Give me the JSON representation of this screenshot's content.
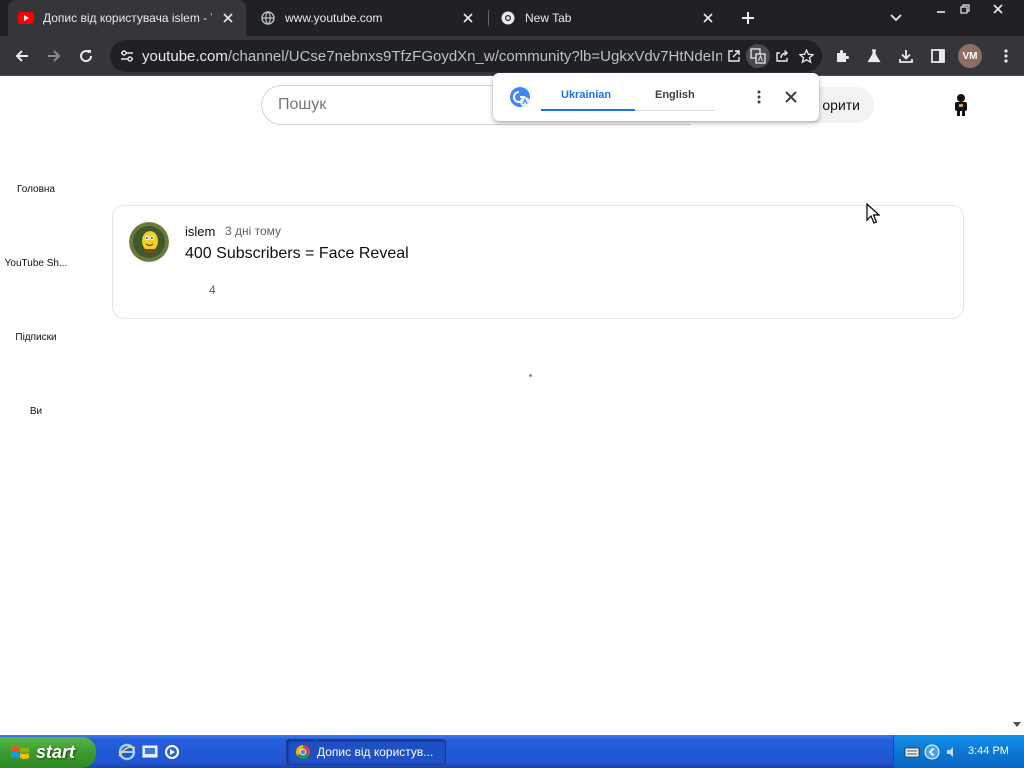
{
  "browser": {
    "tabs": [
      {
        "title": "Допис від користувача islem - YouTube",
        "active": true
      },
      {
        "title": "www.youtube.com",
        "active": false
      },
      {
        "title": "New Tab",
        "active": false
      }
    ],
    "url_host": "youtube.com",
    "url_path": "/channel/UCse7nebnxs9TfzFGoydXn_w/community?lb=UgkxVdv7HtNdeInOFjV...",
    "profile_initials": "VM"
  },
  "youtube": {
    "search_placeholder": "Пошук",
    "create_label": "орити",
    "guide": [
      {
        "label": "Головна"
      },
      {
        "label": "YouTube Sh..."
      },
      {
        "label": "Підписки"
      },
      {
        "label": "Ви"
      }
    ],
    "post": {
      "author": "islem",
      "time": "3 дні тому",
      "text": "400 Subscribers = Face Reveal",
      "likes": "4"
    }
  },
  "translate_popup": {
    "source_lang": "Ukrainian",
    "target_lang": "English"
  },
  "taskbar": {
    "start_label": "start",
    "task_label": "Допис від користув...",
    "clock": "3:44 PM"
  },
  "colors": {
    "chrome_dark": "#202124",
    "chrome_toolbar": "#35363a",
    "google_blue": "#1a73e8",
    "youtube_red": "#ff0000",
    "xp_blue": "#245edb",
    "xp_green": "#3c9a2f"
  }
}
